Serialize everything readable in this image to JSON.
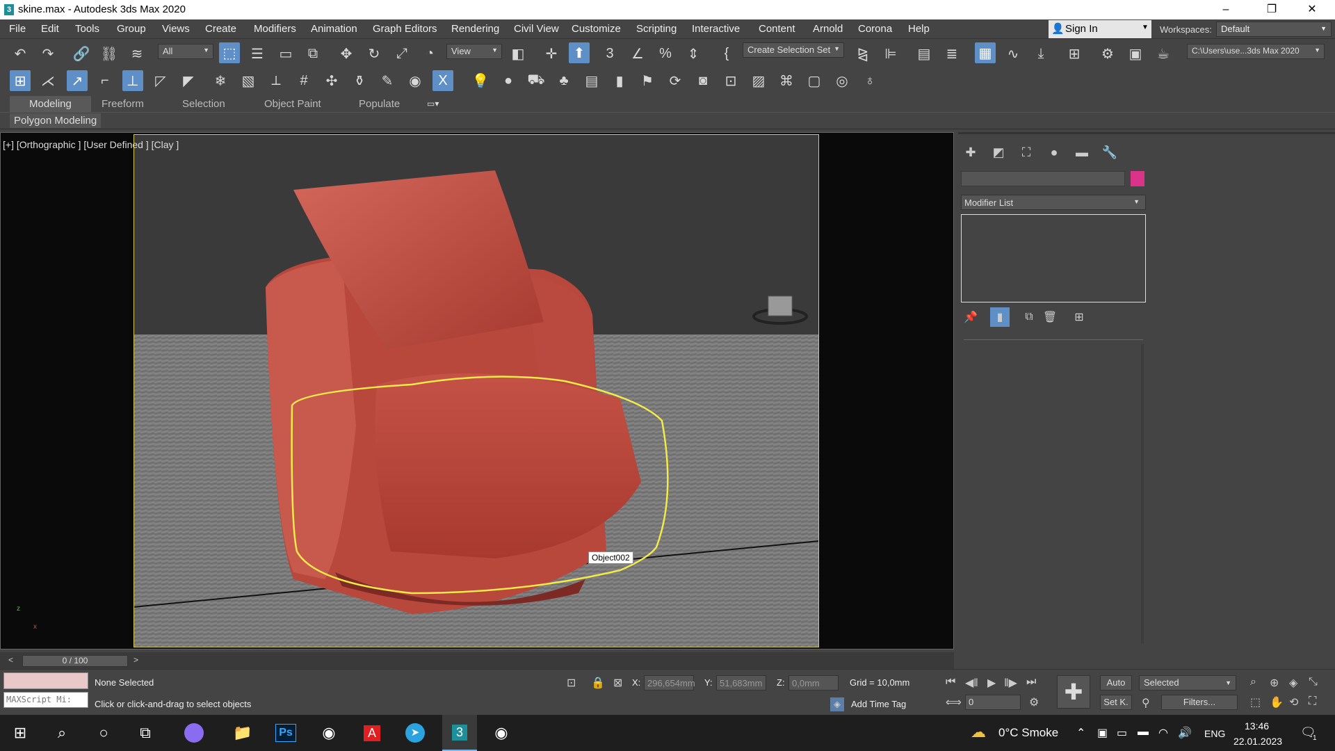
{
  "window": {
    "title": "skine.max - Autodesk 3ds Max 2020",
    "app_icon": "3",
    "min": "–",
    "max": "❐",
    "close": "✕"
  },
  "menu": [
    "File",
    "Edit",
    "Tools",
    "Group",
    "Views",
    "Create",
    "Modifiers",
    "Animation",
    "Graph Editors",
    "Rendering",
    "Civil View",
    "Customize",
    "Scripting",
    "Interactive",
    "Content",
    "Arnold",
    "Corona",
    "Help"
  ],
  "signin": {
    "label": "Sign In"
  },
  "workspaces": {
    "label": "Workspaces:",
    "value": "Default"
  },
  "toolbar": {
    "filter_value": "All",
    "refcoord_value": "View",
    "selection_set": "Create Selection Set",
    "project_path": "C:\\Users\\use...3ds Max 2020"
  },
  "ribbon": {
    "tabs": [
      "Modeling",
      "Freeform",
      "Selection",
      "Object Paint",
      "Populate"
    ],
    "active": "Modeling",
    "panel": "Polygon Modeling"
  },
  "viewport": {
    "label": "[+] [Orthographic ] [User Defined ] [Clay ]",
    "object_label": "Object002",
    "axis_x": "x",
    "axis_z": "z"
  },
  "command_panel": {
    "modifier_list": "Modifier List",
    "swatch_color": "#d9338a"
  },
  "timeline": {
    "value": "0 / 100",
    "prev": "<",
    "next": ">"
  },
  "status": {
    "listener_placeholder": "MAXScript Mi:",
    "selection": "None Selected",
    "prompt": "Click or click-and-drag to select objects",
    "x_label": "X:",
    "x_value": "296,654mm",
    "y_label": "Y:",
    "y_value": "51,683mm",
    "z_label": "Z:",
    "z_value": "0,0mm",
    "grid": "Grid = 10,0mm",
    "add_time_tag": "Add Time Tag",
    "frame_value": "0",
    "auto": "Auto",
    "selected": "Selected",
    "set_key": "Set K.",
    "filters": "Filters..."
  },
  "taskbar": {
    "weather": "0°C  Smoke",
    "lang": "ENG",
    "time": "13:46",
    "date": "22.01.2023",
    "notif_count": "1",
    "photoshop": "Ps"
  }
}
